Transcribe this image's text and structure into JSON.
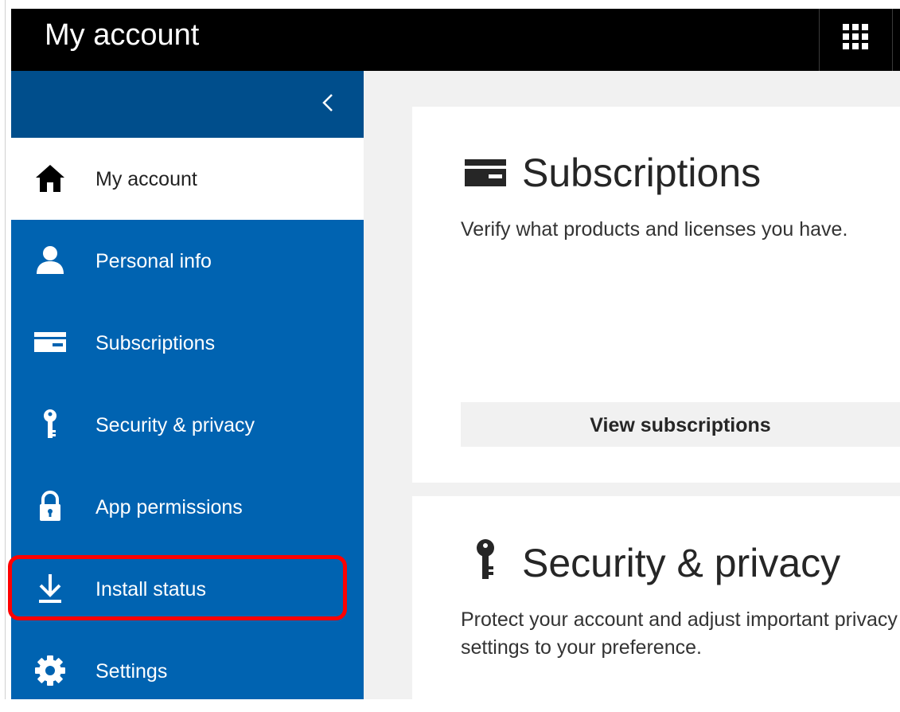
{
  "header": {
    "title": "My account"
  },
  "sidebar": {
    "items": [
      {
        "label": "My account",
        "icon": "home-icon",
        "selected": true
      },
      {
        "label": "Personal info",
        "icon": "person-icon"
      },
      {
        "label": "Subscriptions",
        "icon": "card-icon"
      },
      {
        "label": "Security & privacy",
        "icon": "key-icon"
      },
      {
        "label": "App permissions",
        "icon": "lock-icon"
      },
      {
        "label": "Install status",
        "icon": "download-icon",
        "highlighted": true
      },
      {
        "label": "Settings",
        "icon": "gear-icon"
      }
    ]
  },
  "cards": {
    "subscriptions": {
      "title": "Subscriptions",
      "description": "Verify what products and licenses you have.",
      "button": "View subscriptions",
      "icon": "card-icon"
    },
    "security": {
      "title": "Security & privacy",
      "description": "Protect your account and adjust important privacy settings to your preference.",
      "icon": "key-icon"
    }
  },
  "colors": {
    "sidebar": "#0063b1",
    "sidebar_top": "#004e8c",
    "highlight": "#ff0000",
    "topbar": "#000000"
  }
}
